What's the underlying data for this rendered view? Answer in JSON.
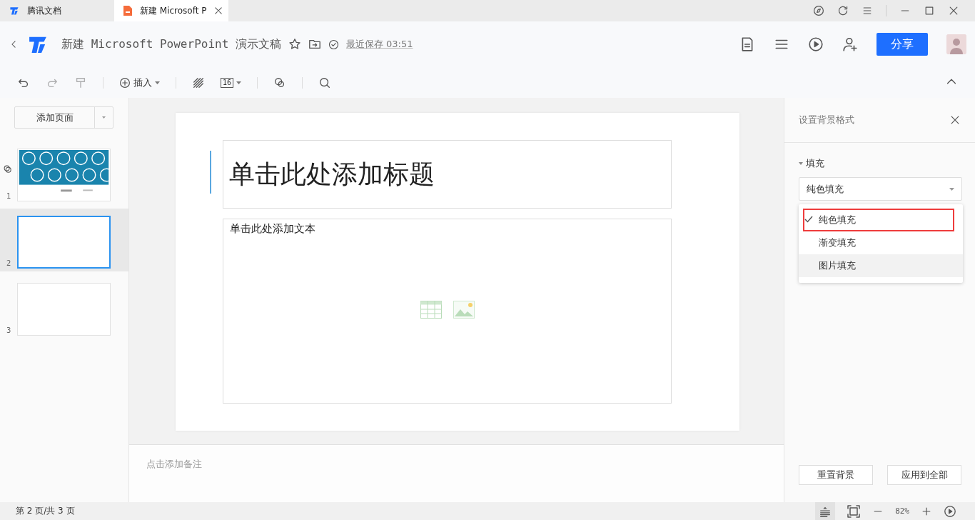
{
  "tabs": [
    {
      "label": "腾讯文档",
      "selected": false
    },
    {
      "label": "新建 Microsoft P",
      "selected": true
    }
  ],
  "header": {
    "title": "新建 Microsoft PowerPoint 演示文稿",
    "save_status": "最近保存 03:51",
    "share_button": "分享"
  },
  "toolbar": {
    "insert": "插入",
    "font_size": "16"
  },
  "slides_panel": {
    "add_button": "添加页面",
    "slides": [
      {
        "number": "1",
        "selected": false,
        "kind": "picture"
      },
      {
        "number": "2",
        "selected": true,
        "kind": "blank"
      },
      {
        "number": "3",
        "selected": false,
        "kind": "blank"
      }
    ]
  },
  "slide": {
    "title_placeholder": "单击此处添加标题",
    "body_placeholder": "单击此处添加文本"
  },
  "notes": {
    "placeholder": "点击添加备注"
  },
  "format_panel": {
    "title": "设置背景格式",
    "section": {
      "label": "填充",
      "expanded": true
    },
    "fill_select": {
      "value": "纯色填充"
    },
    "options": [
      {
        "label": "纯色填充",
        "selected": true,
        "highlighted": true
      },
      {
        "label": "渐变填充",
        "selected": false,
        "highlighted": false
      },
      {
        "label": "图片填充",
        "selected": false,
        "highlighted": false
      }
    ],
    "buttons": [
      "重置背景",
      "应用到全部"
    ]
  },
  "status_bar": {
    "page_info": "第 2 页/共 3 页",
    "zoom": "82%"
  }
}
